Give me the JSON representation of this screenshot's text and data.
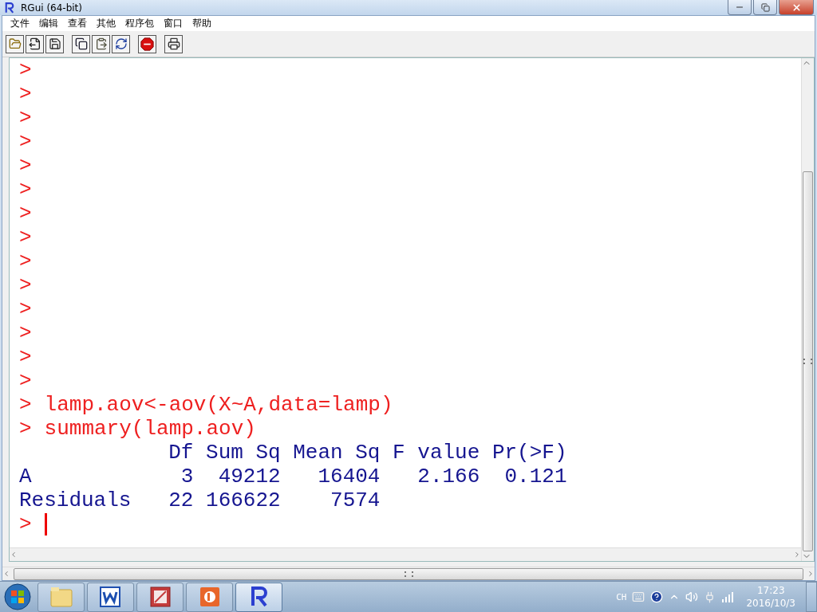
{
  "window": {
    "title": "RGui (64-bit)"
  },
  "menu": [
    "文件",
    "编辑",
    "查看",
    "其他",
    "程序包",
    "窗口",
    "帮助"
  ],
  "toolbar": [
    {
      "kind": "open"
    },
    {
      "kind": "load"
    },
    {
      "kind": "save"
    },
    {
      "kind": "sep"
    },
    {
      "kind": "copy"
    },
    {
      "kind": "paste"
    },
    {
      "kind": "copypaste"
    },
    {
      "kind": "sep"
    },
    {
      "kind": "stop"
    },
    {
      "kind": "sep"
    },
    {
      "kind": "print"
    }
  ],
  "console": [
    {
      "kind": "input",
      "prompt": ">"
    },
    {
      "kind": "input",
      "prompt": ">"
    },
    {
      "kind": "input",
      "prompt": ">"
    },
    {
      "kind": "input",
      "prompt": ">"
    },
    {
      "kind": "input",
      "prompt": ">"
    },
    {
      "kind": "input",
      "prompt": ">"
    },
    {
      "kind": "input",
      "prompt": ">"
    },
    {
      "kind": "input",
      "prompt": ">"
    },
    {
      "kind": "input",
      "prompt": ">"
    },
    {
      "kind": "input",
      "prompt": ">"
    },
    {
      "kind": "input",
      "prompt": ">"
    },
    {
      "kind": "input",
      "prompt": ">"
    },
    {
      "kind": "input",
      "prompt": ">"
    },
    {
      "kind": "input",
      "prompt": ">"
    },
    {
      "kind": "input",
      "prompt": ">",
      "text": "lamp.aov<-aov(X~A,data=lamp)"
    },
    {
      "kind": "input",
      "prompt": ">",
      "text": "summary(lamp.aov)"
    },
    {
      "kind": "output",
      "text": "            Df Sum Sq Mean Sq F value Pr(>F)"
    },
    {
      "kind": "output",
      "text": "A            3  49212   16404   2.166  0.121"
    },
    {
      "kind": "output",
      "text": "Residuals   22 166622    7574"
    },
    {
      "kind": "cursor",
      "prompt": ">"
    }
  ],
  "taskbar": {
    "apps": [
      {
        "kind": "explorer",
        "selected": false
      },
      {
        "kind": "word",
        "selected": false
      },
      {
        "kind": "image",
        "selected": false
      },
      {
        "kind": "powerpoint",
        "selected": false
      },
      {
        "kind": "r",
        "selected": true
      }
    ],
    "language": "CH",
    "time": "17:23",
    "date": "2016/10/3"
  }
}
